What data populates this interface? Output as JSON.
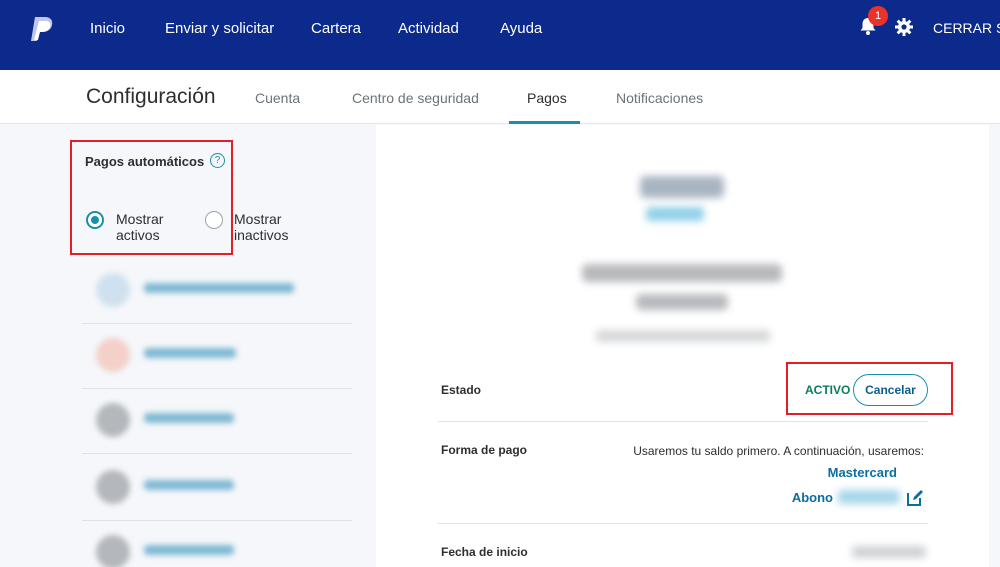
{
  "topnav": {
    "logo_icon": "paypal-logo-icon",
    "items": [
      "Inicio",
      "Enviar y solicitar",
      "Cartera",
      "Actividad",
      "Ayuda"
    ],
    "notifications_count": "1",
    "logout_label": "CERRAR SE"
  },
  "subheader": {
    "title": "Configuración",
    "tabs": [
      "Cuenta",
      "Centro de seguridad",
      "Pagos",
      "Notificaciones"
    ],
    "active_tab": "Pagos"
  },
  "left": {
    "section_title": "Pagos automáticos",
    "help_symbol": "?",
    "filter_options": [
      {
        "label": "Mostrar activos",
        "line1": "Mostrar",
        "line2": "activos",
        "checked": true
      },
      {
        "label": "Mostrar inactivos",
        "line1": "Mostrar",
        "line2": "inactivos",
        "checked": false
      }
    ]
  },
  "detail": {
    "status_label": "Estado",
    "status_value": "ACTIVO",
    "cancel_label": "Cancelar",
    "payment_method_label": "Forma de pago",
    "payment_note": "Usaremos tu saldo primero. A continuación, usaremos:",
    "card_name": "Mastercard",
    "bank_label": "Abono",
    "start_date_label": "Fecha de inicio"
  },
  "colors": {
    "nav_bg": "#0b2a8c",
    "accent": "#1a8fad",
    "status_green": "#0a7d5c",
    "highlight_red": "#e31e24",
    "badge_red": "#e8322a"
  }
}
